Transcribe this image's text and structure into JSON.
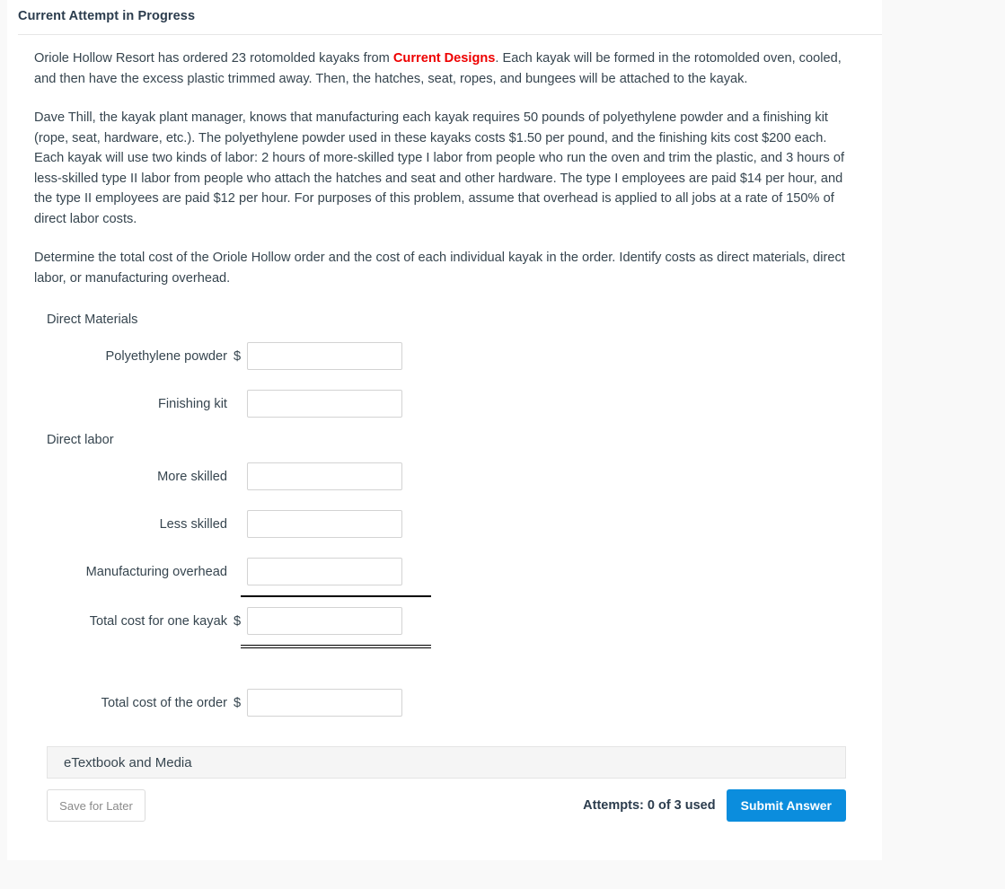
{
  "card": {
    "header_title": "Current Attempt in Progress"
  },
  "problem": {
    "paragraph_1_part_1": "Oriole Hollow Resort has ordered 23 rotomolded kayaks from ",
    "company_link": "Current Designs",
    "paragraph_1_part_2": ". Each kayak will be formed in the rotomolded oven, cooled, and then have the excess plastic trimmed away. Then, the hatches, seat, ropes, and bungees will be attached to the kayak.",
    "paragraph_2": "Dave Thill, the kayak plant manager, knows that manufacturing each kayak requires 50 pounds of polyethylene powder and a finishing kit (rope, seat, hardware, etc.). The polyethylene powder used in these kayaks costs $1.50 per pound, and the finishing kits cost $200 each. Each kayak will use two kinds of labor: 2 hours of more-skilled type I labor from people who run the oven and trim the plastic, and 3 hours of less-skilled type II labor from people who attach the hatches and seat and other hardware. The type I employees are paid $14 per hour, and the type II employees are paid $12 per hour. For purposes of this problem, assume that overhead is applied to all jobs at a rate of 150% of direct labor costs.",
    "paragraph_3": "Determine the total cost of the Oriole Hollow order and the cost of each individual kayak in the order. Identify costs as direct materials, direct labor, or manufacturing overhead."
  },
  "form": {
    "direct_materials_heading": "Direct Materials",
    "direct_labor_heading": "Direct labor",
    "currency_symbol": "$",
    "rows": [
      {
        "label": "Polyethylene powder",
        "dollar": "$",
        "value": "",
        "placeholder": ""
      },
      {
        "label": "Finishing kit",
        "dollar": "",
        "value": "",
        "placeholder": ""
      },
      {
        "label": "More skilled",
        "dollar": "",
        "value": "",
        "placeholder": ""
      },
      {
        "label": "Less skilled",
        "dollar": "",
        "value": "",
        "placeholder": ""
      },
      {
        "label": "Manufacturing overhead",
        "dollar": "",
        "value": "",
        "placeholder": ""
      },
      {
        "label": "Total cost for one kayak",
        "dollar": "$",
        "value": "",
        "placeholder": ""
      },
      {
        "label": "Total cost of the order",
        "dollar": "$",
        "value": "",
        "placeholder": ""
      }
    ]
  },
  "footer": {
    "etextbook_label": "eTextbook and Media",
    "save_label": "Save for Later",
    "attempts_text": "Attempts: 0 of 3 used",
    "submit_label": "Submit Answer"
  },
  "colors": {
    "brand_red": "#ee0000",
    "submit_blue": "#0b8ddd",
    "text": "#36454f",
    "header_text": "#2b3c4d",
    "page_bg": "#f9f9f9",
    "card_bg": "#ffffff",
    "input_border": "#d3d3d3",
    "etextbook_bg": "#f5f5f5"
  }
}
